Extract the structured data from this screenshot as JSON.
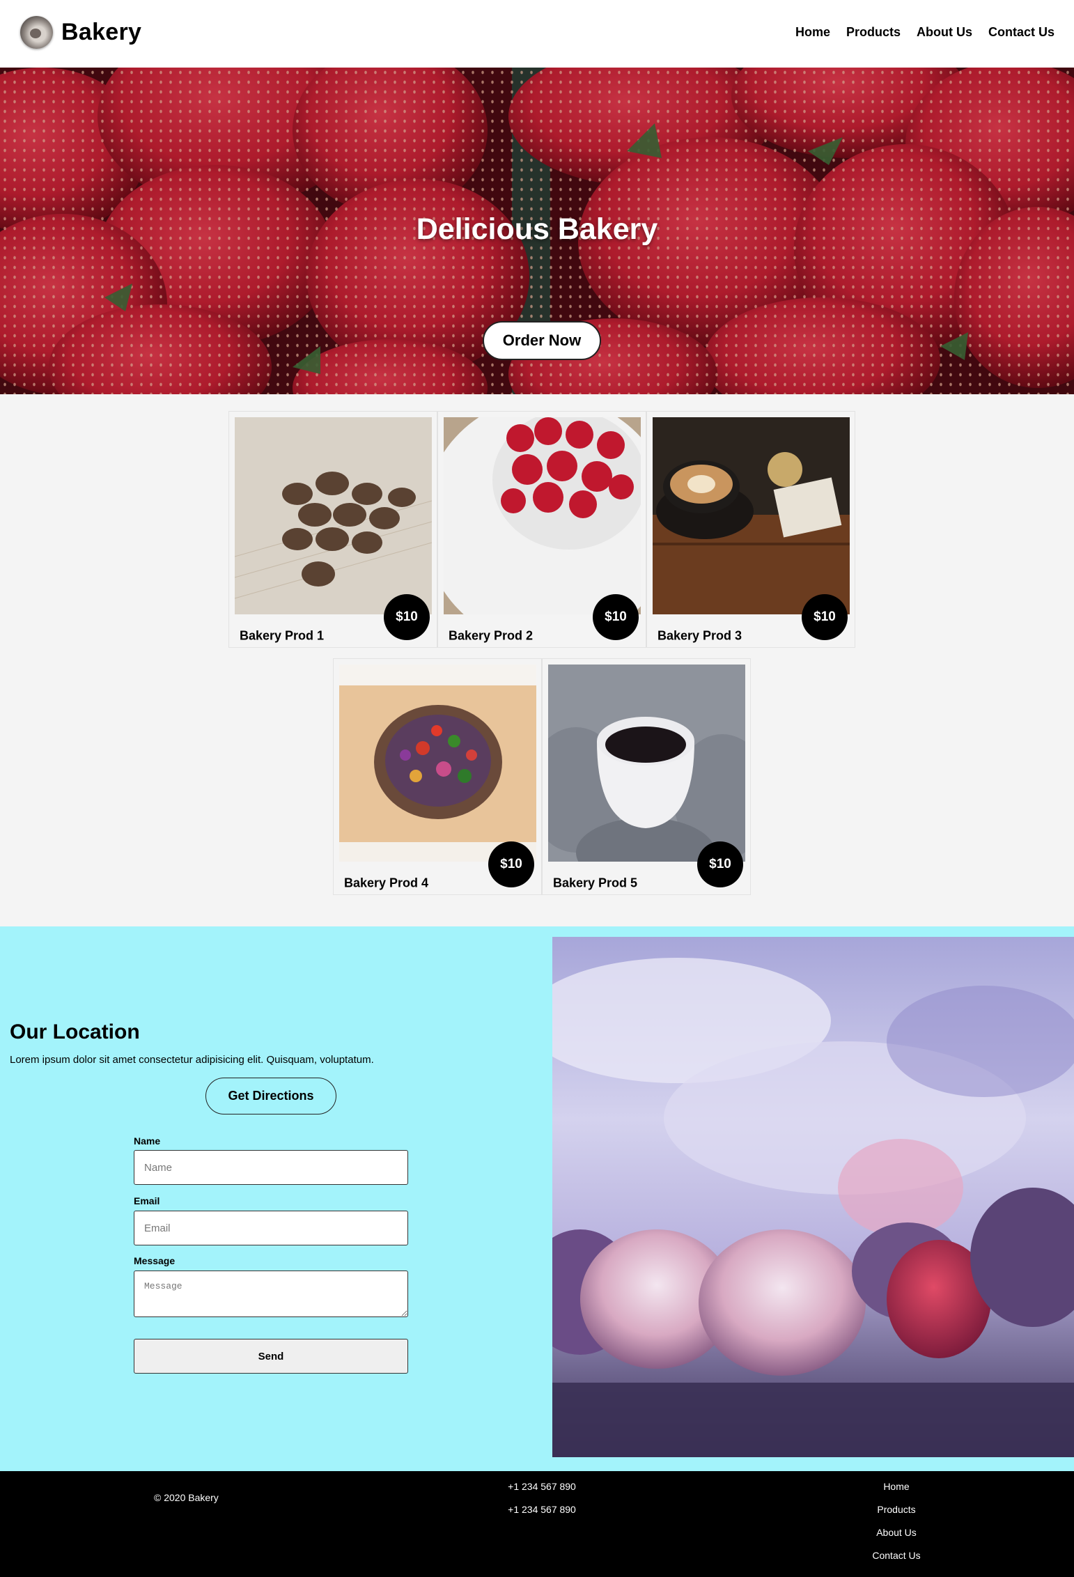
{
  "header": {
    "brand": "Bakery",
    "nav": [
      "Home",
      "Products",
      "About Us",
      "Contact Us"
    ]
  },
  "hero": {
    "title": "Delicious Bakery",
    "button": "Order Now"
  },
  "products": [
    {
      "name": "Bakery Prod 1",
      "price": "$10"
    },
    {
      "name": "Bakery Prod 2",
      "price": "$10"
    },
    {
      "name": "Bakery Prod 3",
      "price": "$10"
    },
    {
      "name": "Bakery Prod 4",
      "price": "$10"
    },
    {
      "name": "Bakery Prod 5",
      "price": "$10"
    }
  ],
  "location": {
    "title": "Our Location",
    "text": "Lorem ipsum dolor sit amet consectetur adipisicing elit. Quisquam, voluptatum.",
    "button": "Get Directions",
    "form": {
      "name_label": "Name",
      "name_placeholder": "Name",
      "name_value": "",
      "email_label": "Email",
      "email_placeholder": "Email",
      "email_value": "",
      "message_label": "Message",
      "message_placeholder": "Message",
      "message_value": "",
      "send": "Send"
    }
  },
  "footer": {
    "copyright": "© 2020 Bakery",
    "phones": [
      "+1 234 567 890",
      "+1 234 567 890"
    ],
    "links": [
      "Home",
      "Products",
      "About Us",
      "Contact Us"
    ]
  },
  "colors": {
    "location_bg": "#a3f3fb",
    "products_bg": "#f4f4f4",
    "footer_bg": "#000000"
  }
}
